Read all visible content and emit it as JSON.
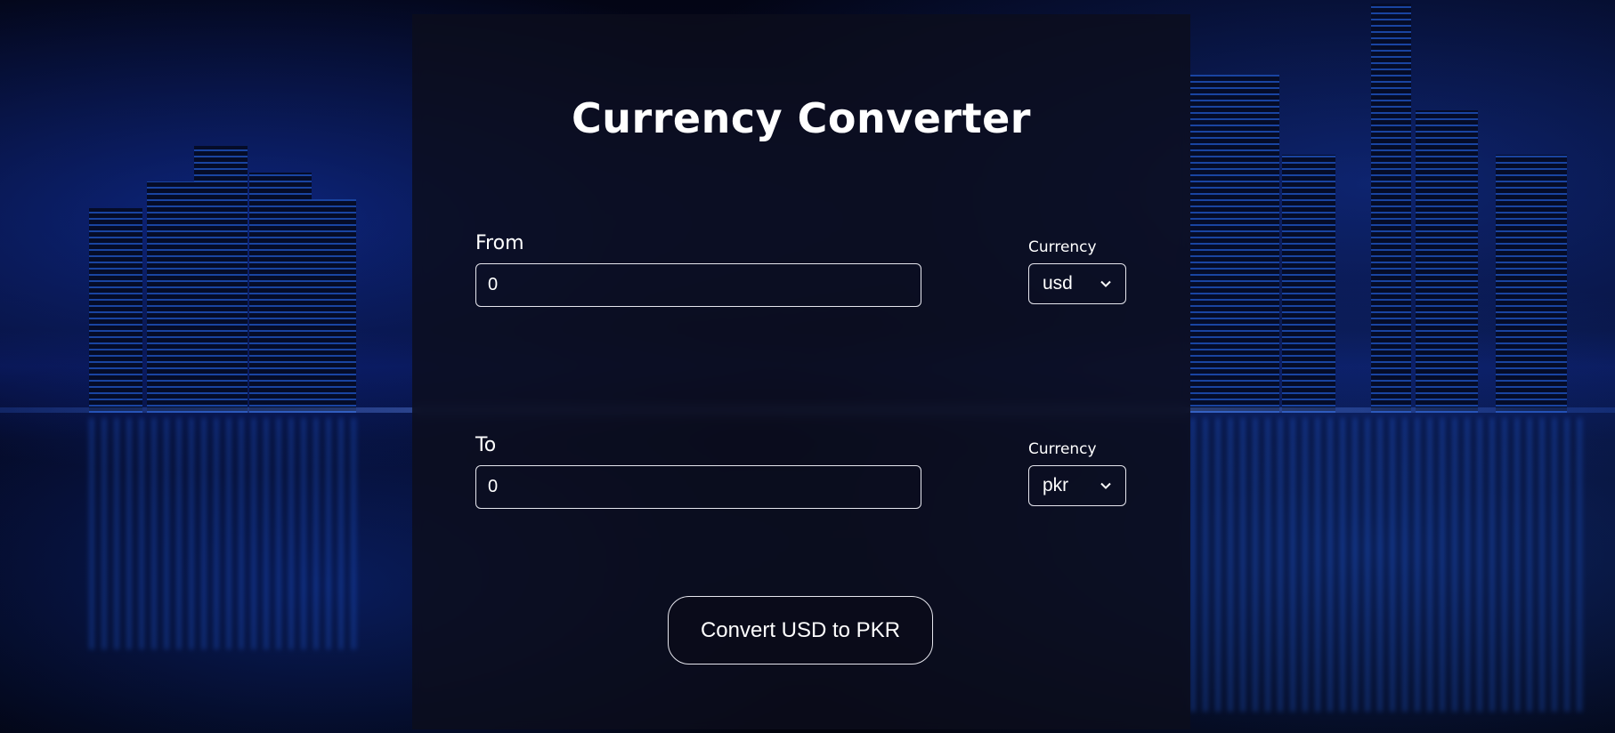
{
  "title": "Currency Converter",
  "from": {
    "label": "From",
    "amount": "0",
    "currency_label": "Currency",
    "currency_value": "usd"
  },
  "to": {
    "label": "To",
    "amount": "0",
    "currency_label": "Currency",
    "currency_value": "pkr"
  },
  "convert_button": {
    "label": "Convert USD to PKR"
  },
  "icons": {
    "select_arrow": "chevron-down-icon"
  },
  "colors": {
    "panel_bg": "#0c0e1c",
    "text": "#ffffff",
    "border": "#e6e6ee",
    "city_blue": "#2a6eff"
  }
}
